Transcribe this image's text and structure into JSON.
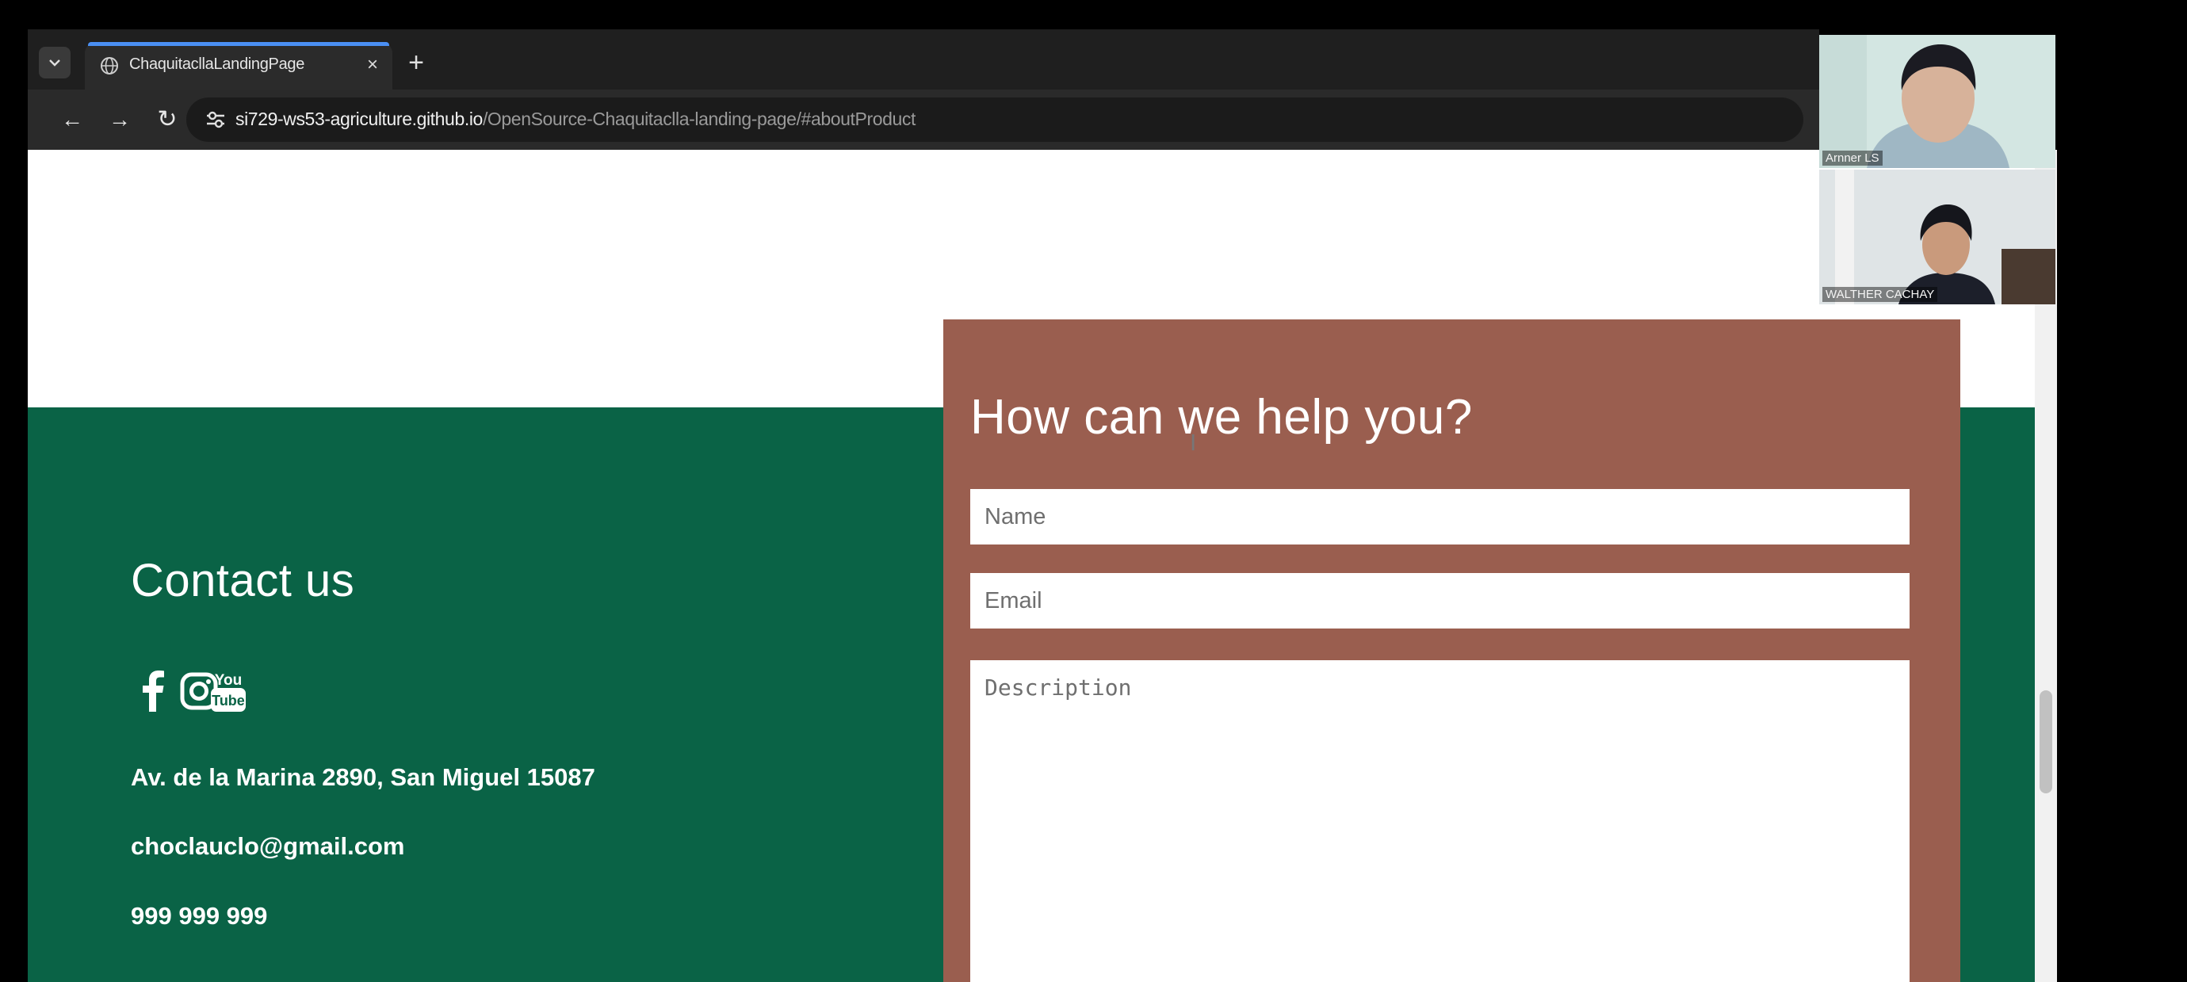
{
  "browser": {
    "tab": {
      "title": "ChaquitacllaLandingPage",
      "close_label": "×",
      "favicon": "globe-icon"
    },
    "new_tab_label": "+",
    "url_host": "si729-ws53-agriculture.github.io",
    "url_path": "/OpenSource-Chaquitaclla-landing-page/#aboutProduct",
    "nav": {
      "back": "←",
      "forward": "→",
      "reload": "↻"
    }
  },
  "contact": {
    "title": "Contact us",
    "social_icons": [
      "facebook-icon",
      "instagram-icon",
      "youtube-icon"
    ],
    "address": "Av. de la Marina 2890, San Miguel 15087",
    "email": "choclauclo@gmail.com",
    "phone": "999 999 999"
  },
  "form": {
    "title": "How can we help you?",
    "name_placeholder": "Name",
    "email_placeholder": "Email",
    "description_placeholder": "Description"
  },
  "video_call": {
    "participants": [
      {
        "name": "Arnner LS"
      },
      {
        "name": "WALTHER CACHAY"
      }
    ]
  },
  "colors": {
    "green_section": "#0a6346",
    "form_card": "#9a5e4f",
    "browser_chrome": "#2a2a2a",
    "tab_accent": "#4a8ff3"
  }
}
